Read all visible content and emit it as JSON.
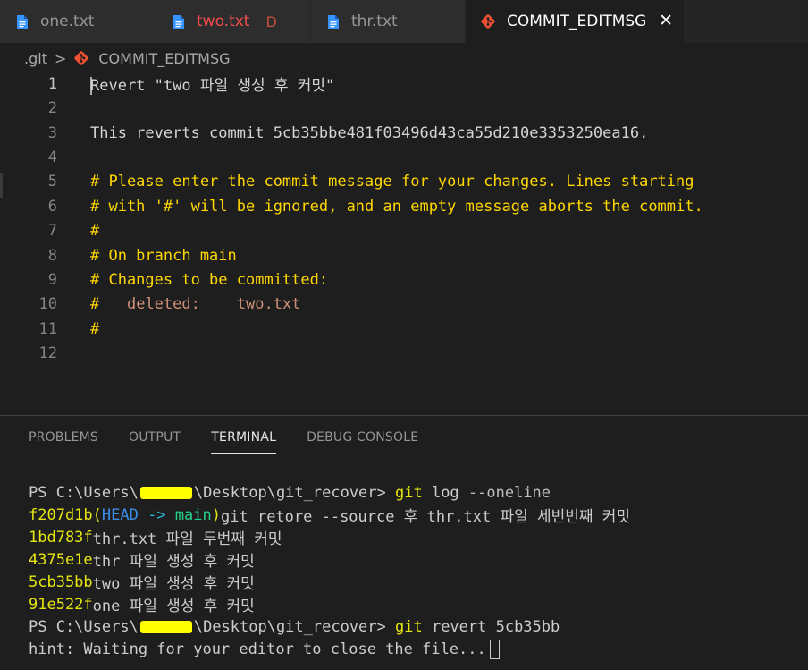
{
  "tabs": [
    {
      "label": "one.txt",
      "icon": "file-icon",
      "state": "normal"
    },
    {
      "label": "two.txt",
      "icon": "file-icon",
      "state": "deleted",
      "flag": "D"
    },
    {
      "label": "thr.txt",
      "icon": "file-icon",
      "state": "normal"
    },
    {
      "label": "COMMIT_EDITMSG",
      "icon": "git-icon",
      "state": "active",
      "close": "✕"
    }
  ],
  "breadcrumb": {
    "folder": ".git",
    "separator": ">",
    "file": "COMMIT_EDITMSG"
  },
  "editor": {
    "lines": [
      {
        "n": "1",
        "text": "Revert \"two 파일 생성 후 커밋\""
      },
      {
        "n": "2",
        "text": ""
      },
      {
        "n": "3",
        "text": "This reverts commit 5cb35bbe481f03496d43ca55d210e3353250ea16."
      },
      {
        "n": "4",
        "text": ""
      },
      {
        "n": "5",
        "text": "# Please enter the commit message for your changes. Lines starting"
      },
      {
        "n": "6",
        "text": "# with '#' will be ignored, and an empty message aborts the commit."
      },
      {
        "n": "7",
        "text": "#"
      },
      {
        "n": "8",
        "text": "# On branch main"
      },
      {
        "n": "9",
        "text": "# Changes to be committed:"
      },
      {
        "n": "10",
        "hash": "#",
        "status": "deleted:",
        "file": "two.txt"
      },
      {
        "n": "11",
        "text": "#"
      },
      {
        "n": "12",
        "text": ""
      }
    ]
  },
  "panel": {
    "tabs": [
      "PROBLEMS",
      "OUTPUT",
      "TERMINAL",
      "DEBUG CONSOLE"
    ],
    "active_tab": "TERMINAL"
  },
  "terminal": {
    "prompt1_pre": "PS C:\\Users\\",
    "prompt1_post": "\\Desktop\\git_recover> ",
    "cmd1_git": "git",
    "cmd1_args": " log ",
    "cmd1_flag": "--oneline",
    "log": [
      {
        "hash": "f207d1b",
        "head": "HEAD -> main",
        "msg": "git retore --source 후 thr.txt 파일 세번번째 커밋"
      },
      {
        "hash": "1bd783f",
        "msg": "thr.txt 파일 두번째 커밋"
      },
      {
        "hash": "4375e1e",
        "msg": "thr 파일 생성 후 커밋"
      },
      {
        "hash": "5cb35bb",
        "msg": "two 파일 생성 후 커밋"
      },
      {
        "hash": "91e522f",
        "msg": "one 파일 생성 후 커밋"
      }
    ],
    "prompt2_pre": "PS C:\\Users\\",
    "prompt2_post": "\\Desktop\\git_recover> ",
    "cmd2_git": "git",
    "cmd2_args": " revert 5cb35bb",
    "hint": "hint: Waiting for your editor to close the file..."
  }
}
